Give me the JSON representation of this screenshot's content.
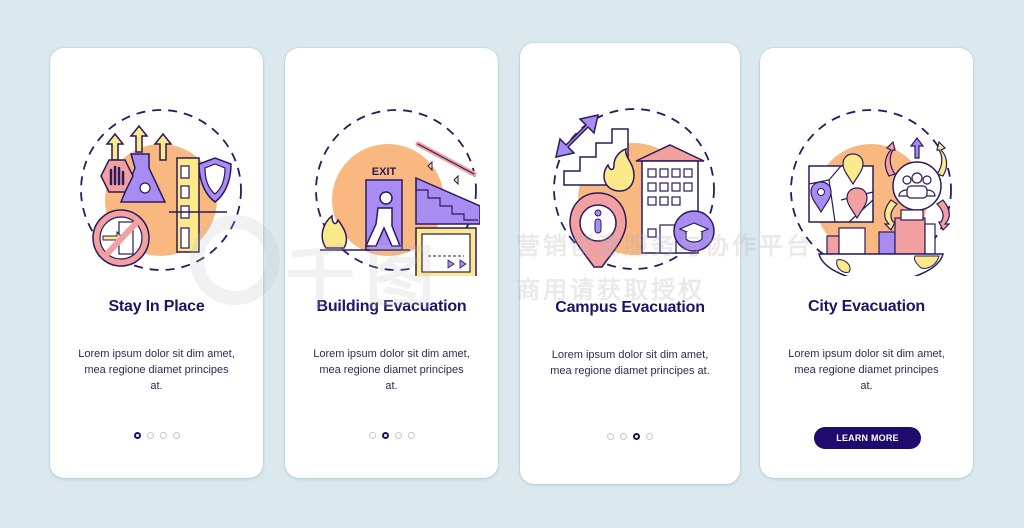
{
  "colors": {
    "background": "#dbe9ef",
    "title": "#1d1466",
    "button": "#1f0a6e",
    "orange": "#f8b880",
    "purple": "#a98cf2",
    "pink": "#f2a0a0",
    "yellow": "#fbe98a",
    "outline": "#2a1a5e"
  },
  "cards": [
    {
      "title": "Stay In Place",
      "description": "Lorem ipsum dolor sit dim amet, mea regione diamet principes at.",
      "illustration": "stay-in-place-illustration",
      "active_page": 1,
      "total_pages": 4
    },
    {
      "title": "Building Evacuation",
      "description": "Lorem ipsum dolor sit dim amet, mea regione diamet principes at.",
      "illustration": "building-evacuation-illustration",
      "exit_sign": "EXIT",
      "active_page": 2,
      "total_pages": 4
    },
    {
      "title": "Campus Evacuation",
      "description": "Lorem ipsum dolor sit dim amet, mea regione diamet principes at.",
      "illustration": "campus-evacuation-illustration",
      "active_page": 3,
      "total_pages": 4
    },
    {
      "title": "City Evacuation",
      "description": "Lorem ipsum dolor sit dim amet, mea regione diamet principes at.",
      "illustration": "city-evacuation-illustration",
      "button_label": "LEARN MORE"
    }
  ],
  "watermark": {
    "big_text": "千图",
    "line1": "营销创意服务与协作平台",
    "line2": "商用请获取授权"
  }
}
